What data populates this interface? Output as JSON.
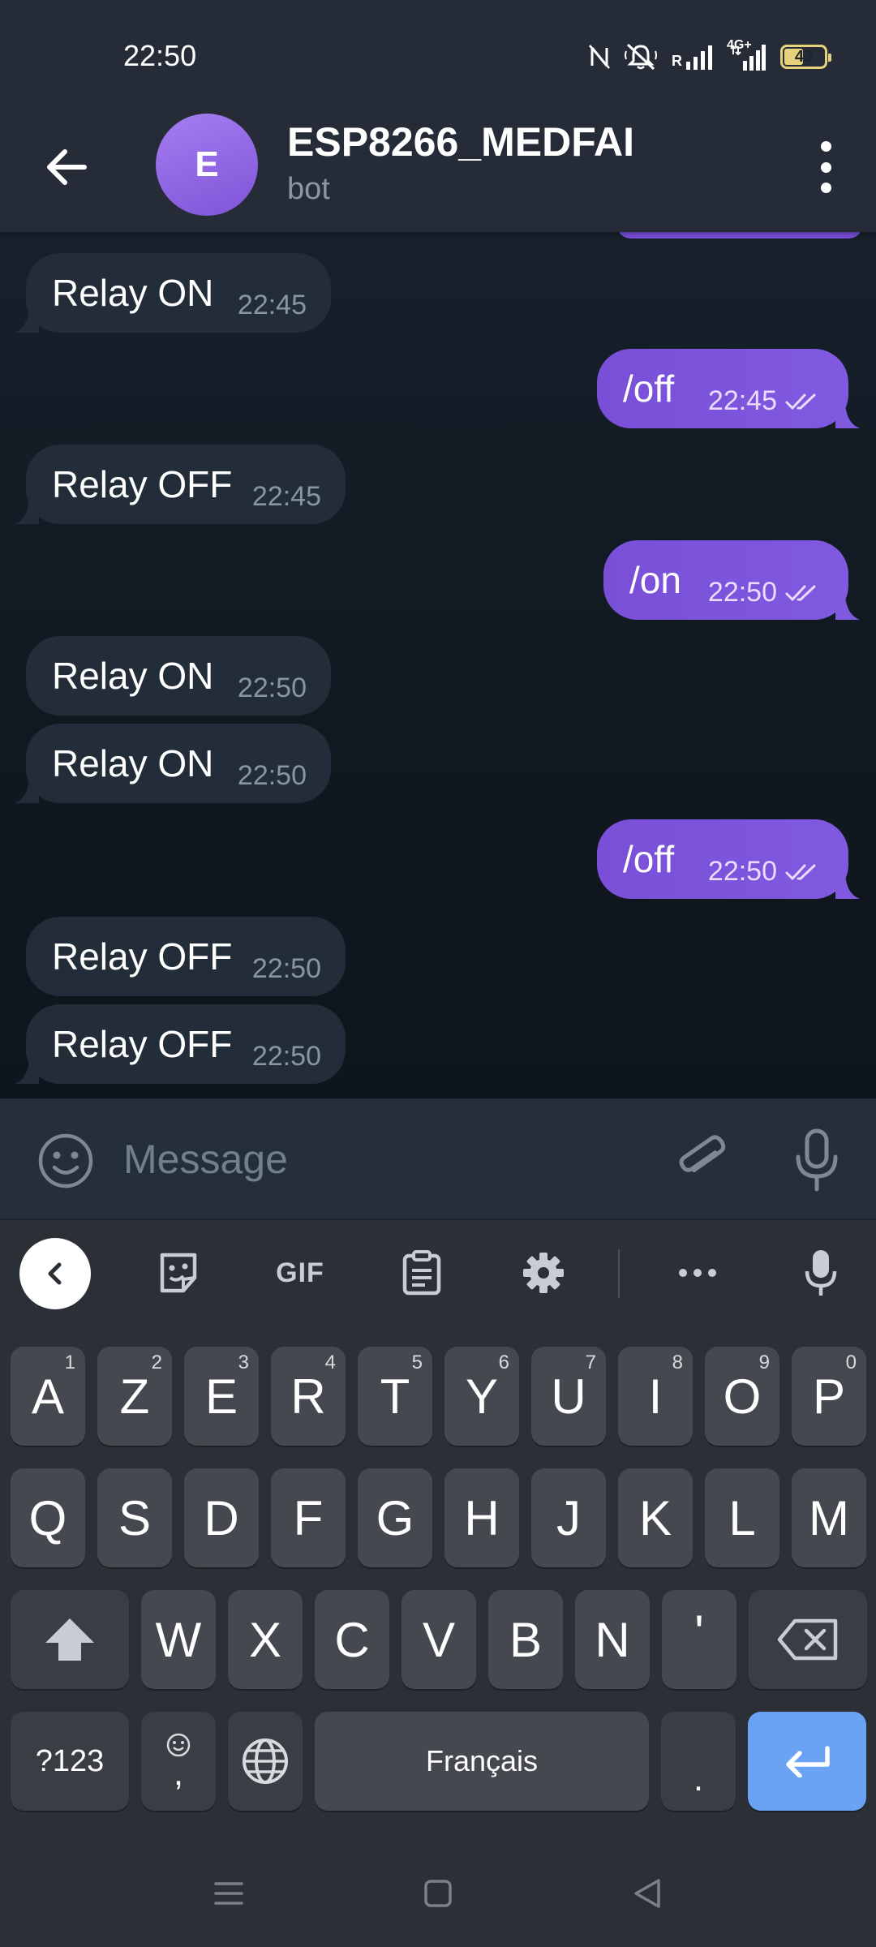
{
  "status_bar": {
    "time": "22:50",
    "net_r": "R",
    "net_4g": "4G+",
    "battery": "43"
  },
  "header": {
    "avatar_letter": "E",
    "title": "ESP8266_MEDFAI",
    "subtitle": "bot"
  },
  "messages": [
    {
      "dir": "in",
      "text": "Relay ON",
      "time": "22:45"
    },
    {
      "dir": "out",
      "text": "/off",
      "time": "22:45"
    },
    {
      "dir": "in",
      "text": "Relay OFF",
      "time": "22:45"
    },
    {
      "dir": "out",
      "text": "/on",
      "time": "22:50"
    },
    {
      "dir": "in",
      "text": "Relay ON",
      "time": "22:50"
    },
    {
      "dir": "in",
      "text": "Relay ON",
      "time": "22:50"
    },
    {
      "dir": "out",
      "text": "/off",
      "time": "22:50"
    },
    {
      "dir": "in",
      "text": "Relay OFF",
      "time": "22:50"
    },
    {
      "dir": "in",
      "text": "Relay OFF",
      "time": "22:50"
    }
  ],
  "input": {
    "placeholder": "Message",
    "value": ""
  },
  "keyboard": {
    "toolbar": {
      "gif_label": "GIF"
    },
    "row1": [
      {
        "label": "A",
        "hint": "1"
      },
      {
        "label": "Z",
        "hint": "2"
      },
      {
        "label": "E",
        "hint": "3"
      },
      {
        "label": "R",
        "hint": "4"
      },
      {
        "label": "T",
        "hint": "5"
      },
      {
        "label": "Y",
        "hint": "6"
      },
      {
        "label": "U",
        "hint": "7"
      },
      {
        "label": "I",
        "hint": "8"
      },
      {
        "label": "O",
        "hint": "9"
      },
      {
        "label": "P",
        "hint": "0"
      }
    ],
    "row2": [
      "Q",
      "S",
      "D",
      "F",
      "G",
      "H",
      "J",
      "K",
      "L",
      "M"
    ],
    "row3": [
      "W",
      "X",
      "C",
      "V",
      "B",
      "N",
      "'"
    ],
    "bottom": {
      "symbols": "?123",
      "comma": ",",
      "space": "Français",
      "period": "."
    }
  },
  "colors": {
    "outgoing_bubble": "#7a4fd8",
    "incoming_bubble": "#232d39",
    "enter_key": "#6aa3f3"
  }
}
